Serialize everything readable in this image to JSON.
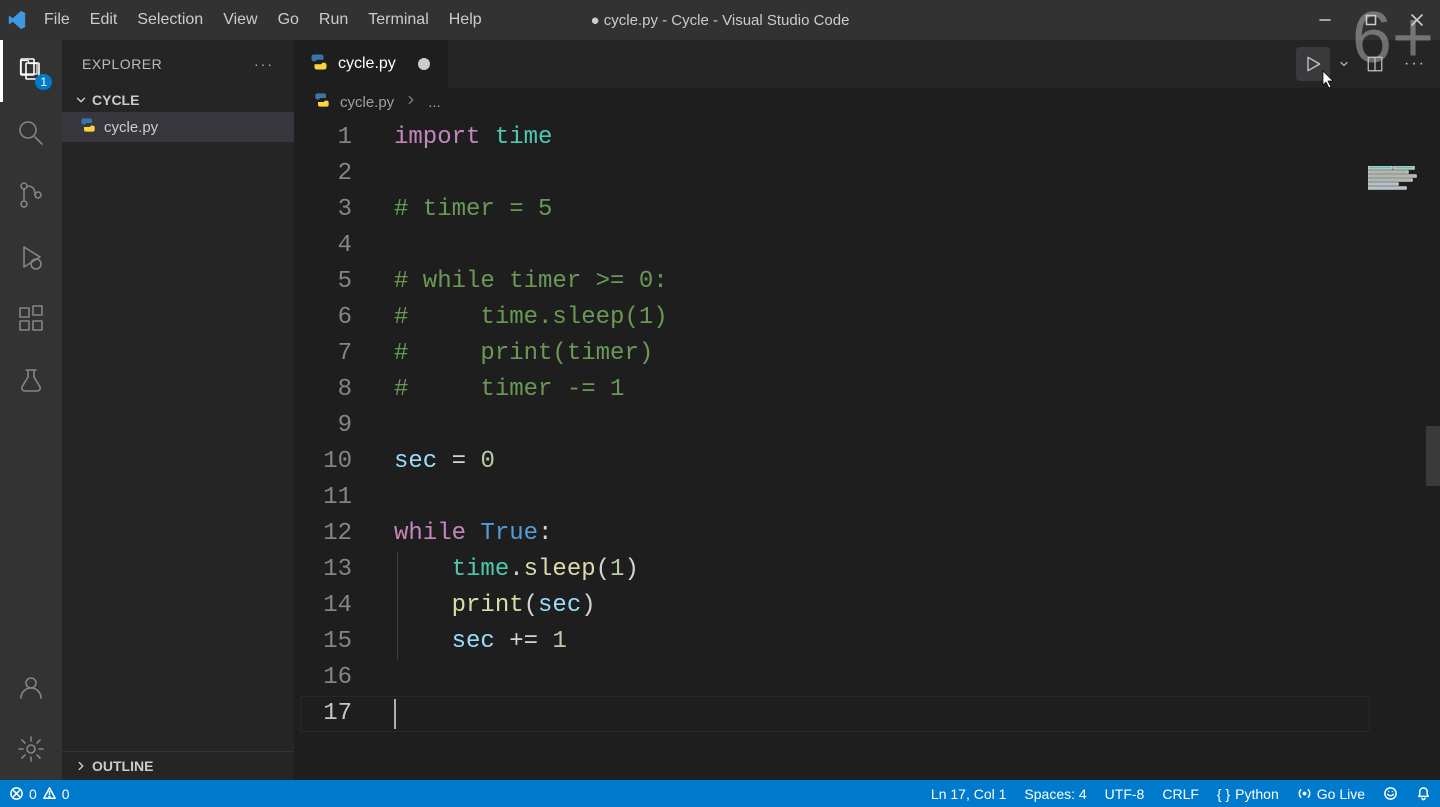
{
  "window": {
    "title": "● cycle.py - Cycle - Visual Studio Code",
    "watermark": "6+"
  },
  "menu": [
    "File",
    "Edit",
    "Selection",
    "View",
    "Go",
    "Run",
    "Terminal",
    "Help"
  ],
  "activity": {
    "items": [
      {
        "name": "explorer-icon",
        "badge": "1",
        "active": true
      },
      {
        "name": "search-icon"
      },
      {
        "name": "scm-icon"
      },
      {
        "name": "run-debug-icon"
      },
      {
        "name": "extensions-icon"
      },
      {
        "name": "testing-icon"
      }
    ],
    "bottom": [
      {
        "name": "accounts-icon"
      },
      {
        "name": "settings-gear-icon"
      }
    ]
  },
  "explorer": {
    "title": "EXPLORER",
    "root": "CYCLE",
    "files": [
      {
        "name": "cycle.py",
        "icon": "python-file-icon",
        "selected": true
      }
    ],
    "outline": "OUTLINE"
  },
  "tabs": {
    "items": [
      {
        "label": "cycle.py",
        "dirty": true
      }
    ]
  },
  "breadcrumb": {
    "file": "cycle.py",
    "tail": "..."
  },
  "code": {
    "lines": [
      {
        "n": 1,
        "tokens": [
          [
            "kw",
            "import"
          ],
          [
            "sp",
            " "
          ],
          [
            "mod",
            "time"
          ]
        ]
      },
      {
        "n": 2,
        "tokens": []
      },
      {
        "n": 3,
        "tokens": [
          [
            "cmt",
            "# timer = 5"
          ]
        ]
      },
      {
        "n": 4,
        "tokens": []
      },
      {
        "n": 5,
        "tokens": [
          [
            "cmt",
            "# while timer >= 0:"
          ]
        ]
      },
      {
        "n": 6,
        "tokens": [
          [
            "cmt",
            "#     time.sleep(1)"
          ]
        ]
      },
      {
        "n": 7,
        "tokens": [
          [
            "cmt",
            "#     print(timer)"
          ]
        ]
      },
      {
        "n": 8,
        "tokens": [
          [
            "cmt",
            "#     timer -= 1"
          ]
        ]
      },
      {
        "n": 9,
        "tokens": []
      },
      {
        "n": 10,
        "tokens": [
          [
            "var",
            "sec"
          ],
          [
            "sp",
            " "
          ],
          [
            "op",
            "="
          ],
          [
            "sp",
            " "
          ],
          [
            "num",
            "0"
          ]
        ]
      },
      {
        "n": 11,
        "tokens": []
      },
      {
        "n": 12,
        "tokens": [
          [
            "kw",
            "while"
          ],
          [
            "sp",
            " "
          ],
          [
            "true",
            "True"
          ],
          [
            "pun",
            ":"
          ]
        ]
      },
      {
        "n": 13,
        "tokens": [
          [
            "sp",
            "    "
          ],
          [
            "mod",
            "time"
          ],
          [
            "pun",
            "."
          ],
          [
            "func",
            "sleep"
          ],
          [
            "pun",
            "("
          ],
          [
            "num",
            "1"
          ],
          [
            "pun",
            ")"
          ]
        ]
      },
      {
        "n": 14,
        "tokens": [
          [
            "sp",
            "    "
          ],
          [
            "func",
            "print"
          ],
          [
            "pun",
            "("
          ],
          [
            "var",
            "sec"
          ],
          [
            "pun",
            ")"
          ]
        ]
      },
      {
        "n": 15,
        "tokens": [
          [
            "sp",
            "    "
          ],
          [
            "var",
            "sec"
          ],
          [
            "sp",
            " "
          ],
          [
            "op",
            "+="
          ],
          [
            "sp",
            " "
          ],
          [
            "num",
            "1"
          ]
        ]
      },
      {
        "n": 16,
        "tokens": []
      },
      {
        "n": 17,
        "tokens": []
      }
    ],
    "cursor_line": 17,
    "indent_guides": [
      {
        "from_line": 13,
        "to_line": 15,
        "col": 0
      }
    ]
  },
  "status": {
    "left": {
      "errors": "0",
      "warnings": "0"
    },
    "right": {
      "cursor": "Ln 17, Col 1",
      "spaces": "Spaces: 4",
      "encoding": "UTF-8",
      "eol": "CRLF",
      "langmode": "Python",
      "golive": "Go Live"
    }
  }
}
